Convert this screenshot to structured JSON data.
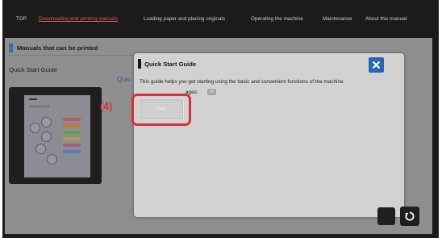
{
  "nav": {
    "items": [
      {
        "label": "TOP"
      },
      {
        "label": "Downloading and printing manuals"
      },
      {
        "label": "Loading paper and placing originals"
      },
      {
        "label": "Operating the machine"
      },
      {
        "label": "Maintenance"
      },
      {
        "label": "About this manual"
      }
    ],
    "active_index": 1
  },
  "page": {
    "section_title": "Manuals that can be printed",
    "left_label": "Quick Start Guide",
    "behind_text": "Quic"
  },
  "dialog": {
    "title": "Quick Start Guide",
    "description": "This guide helps you get starting using the basic and convenient functions of the machine.",
    "pages_label": "ages:",
    "pages_value": "00",
    "print_label": "Print"
  },
  "annotation": {
    "step_label": "(4)"
  },
  "icons": {
    "close": "close-icon",
    "back": "back-arrow-icon"
  },
  "colors": {
    "accent_blue": "#2a66b0",
    "highlight_red": "#d2323a",
    "active_nav": "#e05a5a"
  }
}
